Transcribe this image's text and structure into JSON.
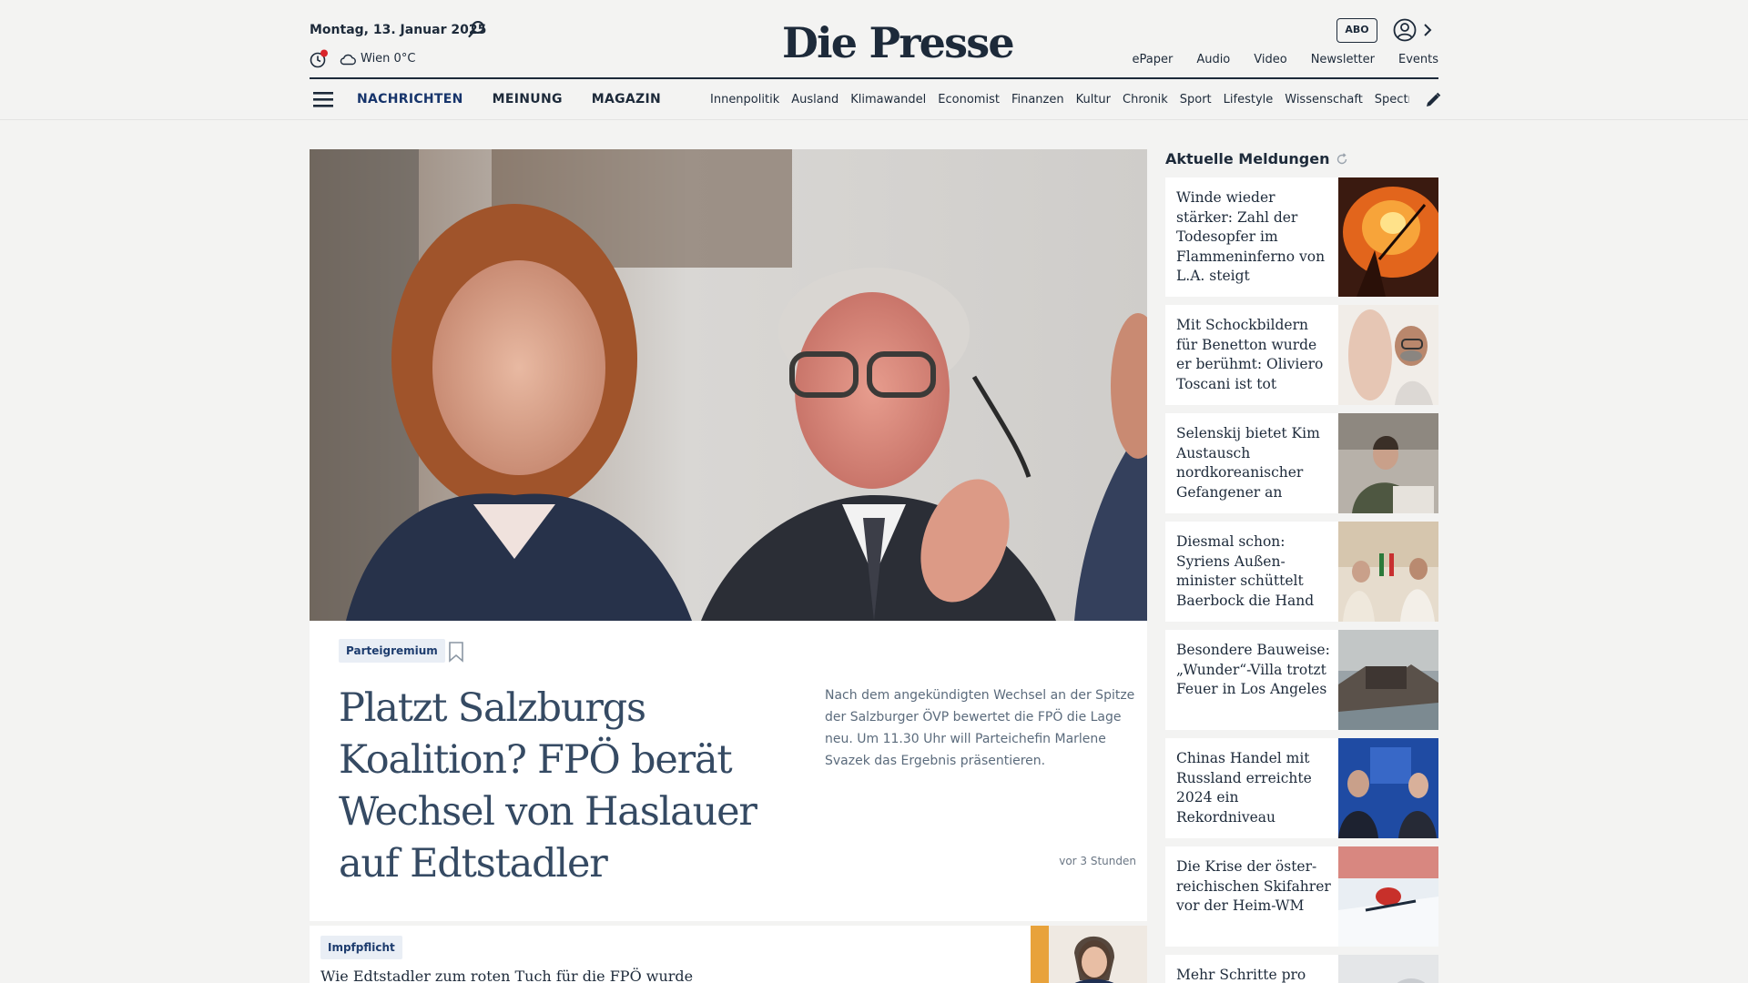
{
  "header": {
    "date": "Montag, 13. Januar 2025",
    "weather": "Wien 0°C",
    "logo": "Die Presse",
    "abo": "ABO",
    "links": [
      "ePaper",
      "Audio",
      "Video",
      "Newsletter",
      "Events"
    ],
    "main_nav": [
      "NACHRICHTEN",
      "MEINUNG",
      "MAGAZIN"
    ],
    "sub_nav": [
      "Innenpolitik",
      "Ausland",
      "Klimawandel",
      "Economist",
      "Finanzen",
      "Kultur",
      "Chronik",
      "Sport",
      "Lifestyle",
      "Wissenschaft",
      "Spectrum"
    ]
  },
  "hero": {
    "tag": "Parteigremium",
    "title": "Platzt Salzburgs Koalition? FPÖ berät Wechsel von Haslauer auf Edtstadler",
    "lead": "Nach dem angekündigten Wechsel an der Spitze der Salzburger ÖVP bewertet die FPÖ die Lage neu. Um 11.30 Uhr will Parteichefin Marlene Svazek das Ergebnis präsentieren.",
    "time": "vor 3 Stunden"
  },
  "second": {
    "tag": "Impfpflicht",
    "title": "Wie Edtstadler zum roten Tuch für die FPÖ wurde"
  },
  "sidebar": {
    "heading": "Aktuelle Meldungen",
    "items": [
      {
        "title": "Winde wieder stärker: Zahl der Todesopfer im Flammeninferno von L.A. steigt"
      },
      {
        "title": "Mit Schockbildern für Benetton wurde er berühmt: Oliviero Toscani ist tot"
      },
      {
        "title": "Selenskij bietet Kim Austausch nordkoreanischer Gefangener an"
      },
      {
        "title": "Diesmal schon: Syriens Außen-minister schüttelt Baerbock die Hand"
      },
      {
        "title": "Besondere Bauweise: „Wunder“-Villa trotzt Feuer in Los Angeles"
      },
      {
        "title": "Chinas Handel mit Russland erreichte 2024 ein Rekordniveau"
      },
      {
        "title": "Die Krise der öster-reichischen Skifahrer vor der Heim-WM"
      },
      {
        "title": "Mehr Schritte pro Tag"
      }
    ]
  }
}
